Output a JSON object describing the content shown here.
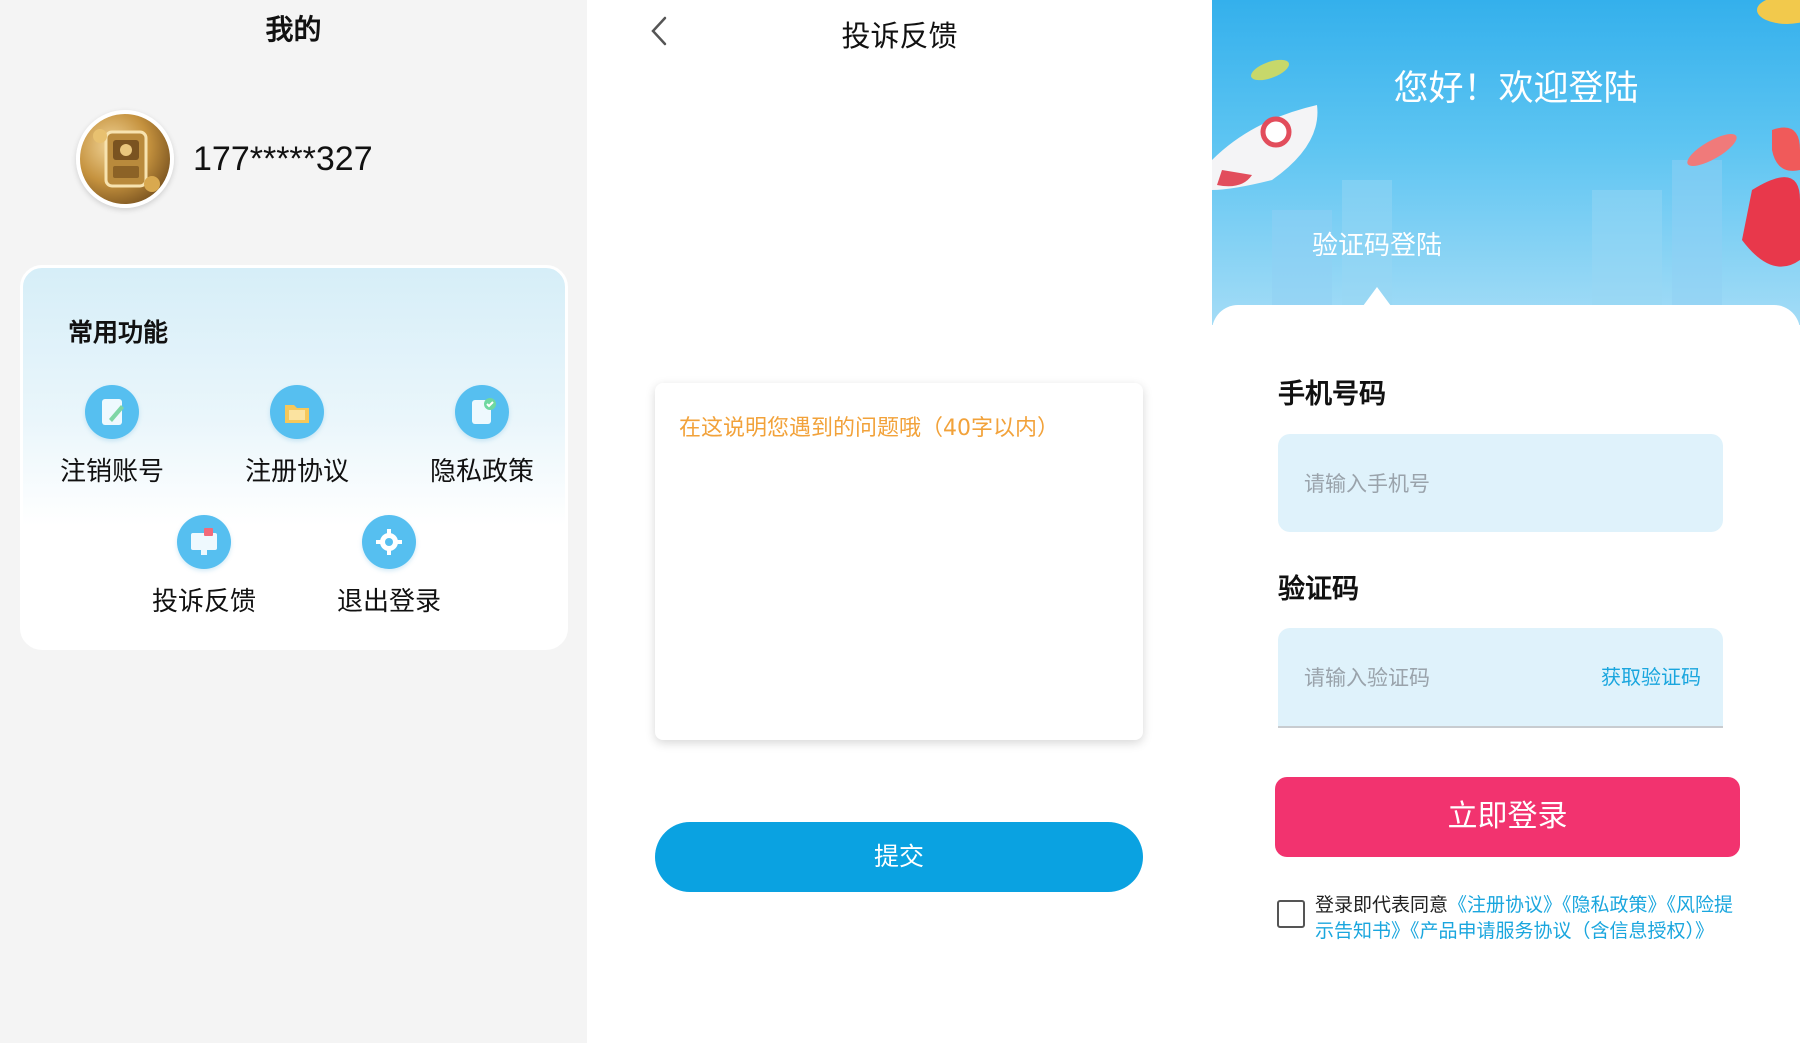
{
  "profile_screen": {
    "title": "我的",
    "phone_masked": "177*****327",
    "common_functions": {
      "title": "常用功能",
      "items": [
        {
          "label": "注销账号",
          "icon": "edit-document-icon"
        },
        {
          "label": "注册协议",
          "icon": "folder-icon"
        },
        {
          "label": "隐私政策",
          "icon": "document-check-icon"
        },
        {
          "label": "投诉反馈",
          "icon": "feedback-monitor-icon"
        },
        {
          "label": "退出登录",
          "icon": "gear-icon"
        }
      ]
    }
  },
  "feedback_screen": {
    "title": "投诉反馈",
    "textarea_placeholder": "在这说明您遇到的问题哦（40字以内）",
    "submit_label": "提交"
  },
  "login_screen": {
    "welcome": "您好！欢迎登陆",
    "tab_label": "验证码登陆",
    "phone_label": "手机号码",
    "phone_placeholder": "请输入手机号",
    "code_label": "验证码",
    "code_placeholder": "请输入验证码",
    "get_code_label": "获取验证码",
    "login_button": "立即登录",
    "agreement": {
      "prefix": "登录即代表同意",
      "links": [
        "《注册协议》",
        "《隐私政策》",
        "《风险提示告知书》",
        "《产品申请服务协议（含信息授权）》"
      ]
    }
  },
  "colors": {
    "accent_blue": "#0aa2e1",
    "login_pink": "#f2336f",
    "placeholder_orange": "#f2a23a",
    "link_blue": "#1aa6de"
  }
}
